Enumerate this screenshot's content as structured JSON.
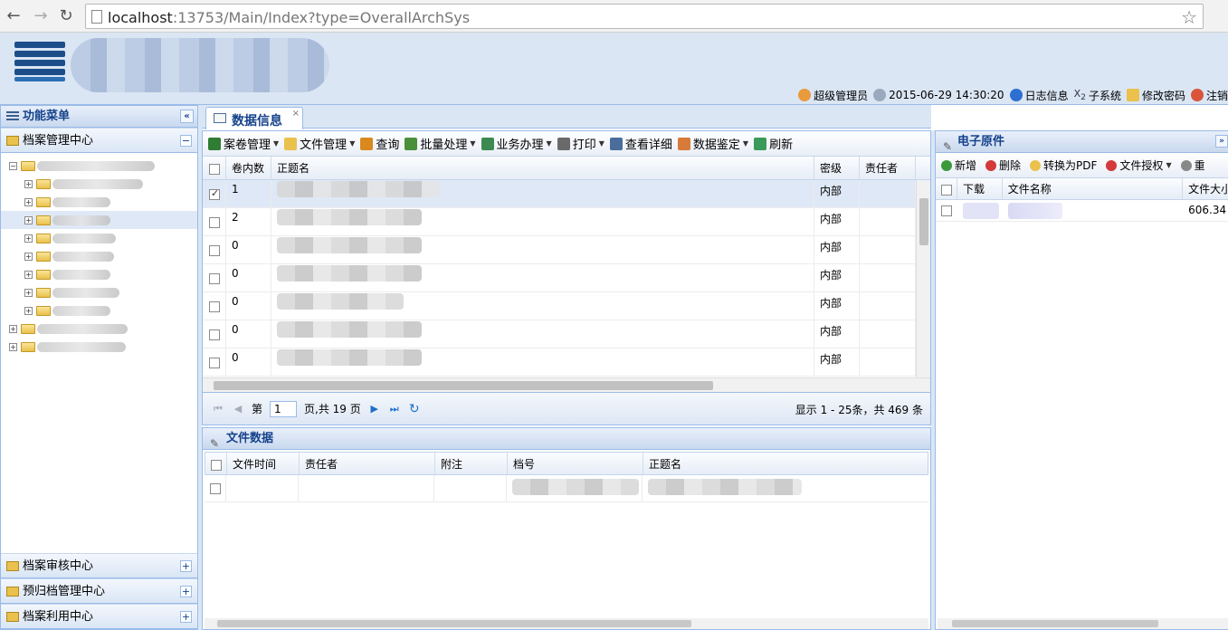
{
  "browser": {
    "url_host": "localhost",
    "url_rest": ":13753/Main/Index?type=OverallArchSys"
  },
  "header": {
    "user": "超级管理员",
    "datetime": "2015-06-29 14:30:20",
    "log": "日志信息",
    "subsystem": "子系统",
    "change_password": "修改密码",
    "logout": "注销"
  },
  "left_menu": {
    "title": "功能菜单",
    "active_section": "档案管理中心",
    "sections_bottom": [
      "档案审核中心",
      "预归档管理中心",
      "档案利用中心"
    ]
  },
  "tabs": [
    {
      "label": "数据信息",
      "close": "×"
    }
  ],
  "toolbar": {
    "items": [
      {
        "label": "案卷管理",
        "dropdown": true,
        "icon": "case-manage-icon",
        "color": "#2e7d32"
      },
      {
        "label": "文件管理",
        "dropdown": true,
        "icon": "folder-icon",
        "color": "#e9c14c"
      },
      {
        "label": "查询",
        "dropdown": false,
        "icon": "search-icon",
        "color": "#d88a1f"
      },
      {
        "label": "批量处理",
        "dropdown": true,
        "icon": "batch-icon",
        "color": "#4a8f3a"
      },
      {
        "label": "业务办理",
        "dropdown": true,
        "icon": "business-icon",
        "color": "#3c8a52"
      },
      {
        "label": "打印",
        "dropdown": true,
        "icon": "printer-icon",
        "color": "#6a6a6a"
      },
      {
        "label": "查看详细",
        "dropdown": false,
        "icon": "detail-icon",
        "color": "#4a6d9c"
      },
      {
        "label": "数据鉴定",
        "dropdown": true,
        "icon": "identify-icon",
        "color": "#d77a3a"
      },
      {
        "label": "刷新",
        "dropdown": false,
        "icon": "refresh-icon",
        "color": "#3a9a5a"
      }
    ]
  },
  "grid": {
    "columns": [
      "卷内数",
      "正题名",
      "密级",
      "责任者"
    ],
    "rows": [
      {
        "count": "1",
        "secret": "内部",
        "checked": true
      },
      {
        "count": "2",
        "secret": "内部",
        "checked": false
      },
      {
        "count": "0",
        "secret": "内部",
        "checked": false
      },
      {
        "count": "0",
        "secret": "内部",
        "checked": false
      },
      {
        "count": "0",
        "secret": "内部",
        "checked": false
      },
      {
        "count": "0",
        "secret": "内部",
        "checked": false
      },
      {
        "count": "0",
        "secret": "内部",
        "checked": false
      }
    ]
  },
  "pager": {
    "page_prefix": "第",
    "current_page": "1",
    "page_suffix": "页,共 19 页",
    "summary": "显示 1 - 25条，共 469 条"
  },
  "file_panel": {
    "title": "文件数据",
    "columns": [
      "文件时间",
      "责任者",
      "附注",
      "档号",
      "正题名"
    ]
  },
  "right_panel": {
    "title": "电子原件",
    "toolbar": [
      {
        "label": "新增",
        "dropdown": false,
        "icon": "add-icon",
        "color": "#3a9a3a"
      },
      {
        "label": "删除",
        "dropdown": false,
        "icon": "delete-icon",
        "color": "#d33a3a"
      },
      {
        "label": "转换为PDF",
        "dropdown": false,
        "icon": "convert-icon",
        "color": "#e9c14c"
      },
      {
        "label": "文件授权",
        "dropdown": true,
        "icon": "authorize-icon",
        "color": "#d33a3a"
      },
      {
        "label": "重",
        "dropdown": false,
        "icon": "rename-icon",
        "color": "#888888"
      }
    ],
    "columns": [
      "下载",
      "文件名称",
      "文件大小"
    ],
    "rows": [
      {
        "size": "606.34"
      }
    ]
  }
}
